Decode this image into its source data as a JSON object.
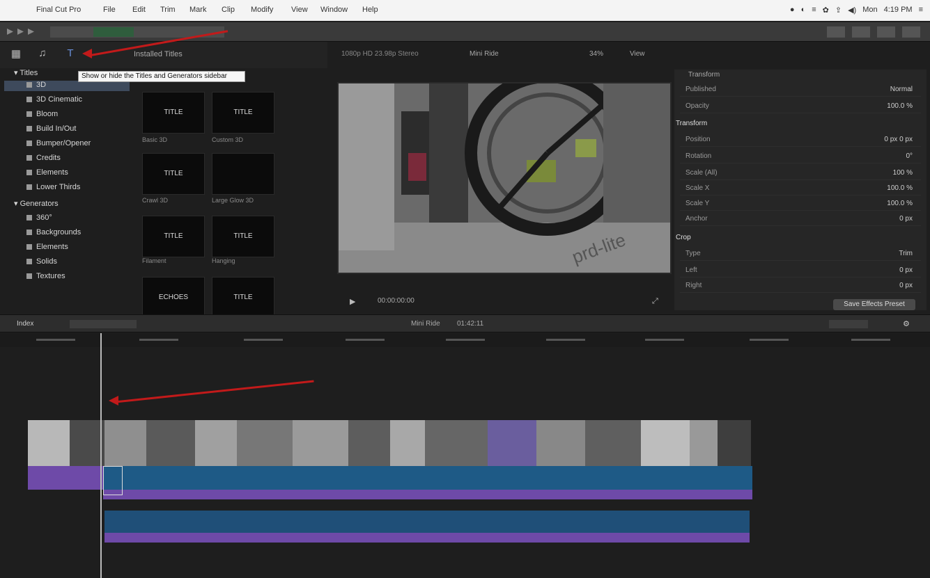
{
  "menubar": {
    "app": "Final Cut Pro",
    "items": [
      "File",
      "Edit",
      "Trim",
      "Mark",
      "Clip",
      "Modify",
      "View",
      "Window",
      "Help"
    ],
    "tray": [
      "●",
      "◐",
      "≡",
      "✿",
      "⇪",
      "◀)",
      "Mon",
      "4:19 PM",
      "≡"
    ]
  },
  "browser": {
    "title": "Installed Titles",
    "sidebar": [
      {
        "label": "Titles",
        "level": 0
      },
      {
        "label": "3D",
        "level": 1,
        "selected": true
      },
      {
        "label": "3D Cinematic",
        "level": 1
      },
      {
        "label": "Bloom",
        "level": 1
      },
      {
        "label": "Build In/Out",
        "level": 1
      },
      {
        "label": "Bumper/Opener",
        "level": 1
      },
      {
        "label": "Credits",
        "level": 1
      },
      {
        "label": "Elements",
        "level": 1
      },
      {
        "label": "Lower Thirds",
        "level": 1
      },
      {
        "label": "Generators",
        "level": 0
      },
      {
        "label": "360°",
        "level": 1
      },
      {
        "label": "Backgrounds",
        "level": 1
      },
      {
        "label": "Elements",
        "level": 1
      },
      {
        "label": "Solids",
        "level": 1
      },
      {
        "label": "Textures",
        "level": 1
      }
    ],
    "tooltip": "Show or hide the Titles and Generators sidebar",
    "thumbnails": [
      {
        "title": "TITLE",
        "label": "Basic 3D"
      },
      {
        "title": "TITLE",
        "label": "Custom 3D"
      },
      {
        "title": "TITLE",
        "label": "Crawl 3D"
      },
      {
        "title": "",
        "label": "Large Glow 3D"
      },
      {
        "title": "TITLE",
        "label": "Filament"
      },
      {
        "title": "TITLE",
        "label": "Hanging"
      },
      {
        "title": "ECHOES",
        "label": ""
      },
      {
        "title": "TITLE",
        "label": ""
      }
    ]
  },
  "viewer": {
    "format": "1080p HD 23.98p Stereo",
    "project": "Mini Ride",
    "zoom": "34%",
    "view": "View",
    "controls": [
      "▶",
      "00:00:00:00",
      "⤢"
    ],
    "watermark": "prd-lite"
  },
  "inspector": {
    "title": "Transform",
    "rows": [
      {
        "name": "Published",
        "value": "Normal"
      },
      {
        "name": "Opacity",
        "value": "100.0 %"
      },
      {
        "name": "Transform",
        "value": ""
      },
      {
        "name": "Position",
        "value": "0 px   0 px"
      },
      {
        "name": "Rotation",
        "value": "0°"
      },
      {
        "name": "Scale (All)",
        "value": "100 %"
      },
      {
        "name": "Scale X",
        "value": "100.0 %"
      },
      {
        "name": "Scale Y",
        "value": "100.0 %"
      },
      {
        "name": "Anchor",
        "value": "0 px"
      },
      {
        "name": "Crop",
        "value": ""
      },
      {
        "name": "Type",
        "value": "Trim"
      },
      {
        "name": "Left",
        "value": "0 px"
      },
      {
        "name": "Right",
        "value": "0 px"
      }
    ],
    "save_label": "Save Effects Preset"
  },
  "timeline": {
    "index_label": "Index",
    "project_label": "Mini Ride",
    "duration": "01:42:11",
    "zoom_label": "⚙"
  }
}
